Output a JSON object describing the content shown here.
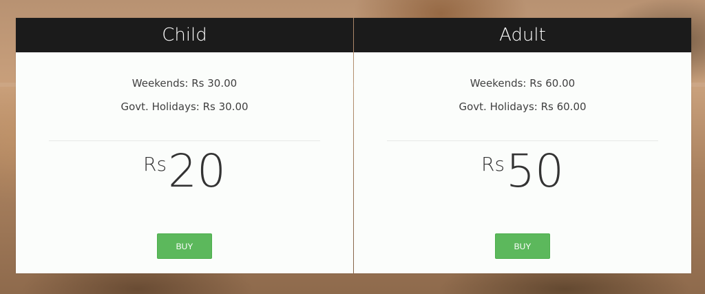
{
  "plans": [
    {
      "title": "Child",
      "weekends": "Weekends: Rs 30.00",
      "holidays": "Govt. Holidays: Rs 30.00",
      "currency": "Rs",
      "price": "20",
      "button_label": "BUY"
    },
    {
      "title": "Adult",
      "weekends": "Weekends: Rs 60.00",
      "holidays": "Govt. Holidays: Rs 60.00",
      "currency": "Rs",
      "price": "50",
      "button_label": "BUY"
    }
  ],
  "colors": {
    "header_bg": "#1b1b1b",
    "card_bg": "#fbfdfb",
    "button_bg": "#5cb85c",
    "text": "#3f3f3f"
  }
}
